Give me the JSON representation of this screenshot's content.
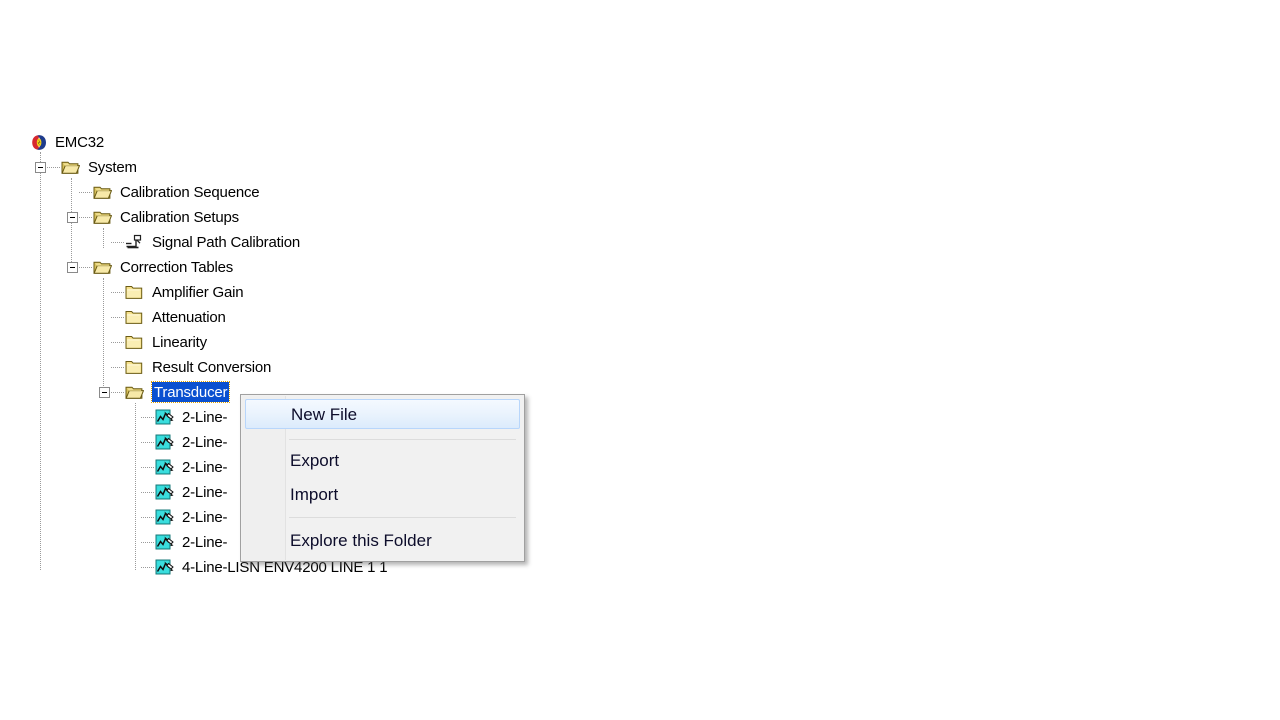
{
  "app": {
    "root_label": "EMC32",
    "root_icon": "rohde-schwarz-logo-icon"
  },
  "tree": {
    "nodes": [
      {
        "label": "EMC32",
        "level": 0,
        "icon": "rohde-schwarz-logo-icon",
        "expander": "none",
        "selected": false
      },
      {
        "label": "System",
        "level": 1,
        "icon": "folder-open-icon",
        "expander": "collapse",
        "selected": false
      },
      {
        "label": "Calibration Sequence",
        "level": 2,
        "icon": "folder-open-icon",
        "expander": "none",
        "selected": false
      },
      {
        "label": "Calibration Setups",
        "level": 2,
        "icon": "folder-open-icon",
        "expander": "collapse",
        "selected": false
      },
      {
        "label": "Signal Path Calibration",
        "level": 3,
        "icon": "signal-path-icon",
        "expander": "none",
        "selected": false
      },
      {
        "label": "Correction Tables",
        "level": 2,
        "icon": "folder-open-icon",
        "expander": "collapse",
        "selected": false
      },
      {
        "label": "Amplifier Gain",
        "level": 3,
        "icon": "folder-closed-icon",
        "expander": "none",
        "selected": false
      },
      {
        "label": "Attenuation",
        "level": 3,
        "icon": "folder-closed-icon",
        "expander": "none",
        "selected": false
      },
      {
        "label": "Linearity",
        "level": 3,
        "icon": "folder-closed-icon",
        "expander": "none",
        "selected": false
      },
      {
        "label": "Result Conversion",
        "level": 3,
        "icon": "folder-closed-icon",
        "expander": "none",
        "selected": false
      },
      {
        "label": "Transducer",
        "level": 3,
        "icon": "folder-open-icon",
        "expander": "collapse",
        "selected": true
      },
      {
        "label": "2-Line-",
        "level": 4,
        "icon": "correction-table-icon",
        "expander": "none",
        "selected": false
      },
      {
        "label": "2-Line-",
        "level": 4,
        "icon": "correction-table-icon",
        "expander": "none",
        "selected": false
      },
      {
        "label": "2-Line-",
        "level": 4,
        "icon": "correction-table-icon",
        "expander": "none",
        "selected": false
      },
      {
        "label": "2-Line-",
        "level": 4,
        "icon": "correction-table-icon",
        "expander": "none",
        "selected": false
      },
      {
        "label": "2-Line-",
        "level": 4,
        "icon": "correction-table-icon",
        "expander": "none",
        "selected": false
      },
      {
        "label": "2-Line-",
        "level": 4,
        "icon": "correction-table-icon",
        "expander": "none",
        "selected": false
      },
      {
        "label": "4-Line-LISN ENV4200 LINE 1 1",
        "level": 4,
        "icon": "correction-table-icon",
        "expander": "none",
        "selected": false
      }
    ]
  },
  "context_menu": {
    "items": [
      {
        "label": "New File",
        "highlighted": true
      },
      {
        "label": "Export",
        "highlighted": false
      },
      {
        "label": "Import",
        "highlighted": false
      },
      {
        "label": "Explore this Folder",
        "highlighted": false
      }
    ]
  },
  "colors": {
    "selection_blue": "#0a50d0",
    "menu_background": "#f1f1f1",
    "menu_highlight": "#dcebfc",
    "folder_yellow": "#f5e08a",
    "table_icon_cyan": "#27d2d2"
  }
}
